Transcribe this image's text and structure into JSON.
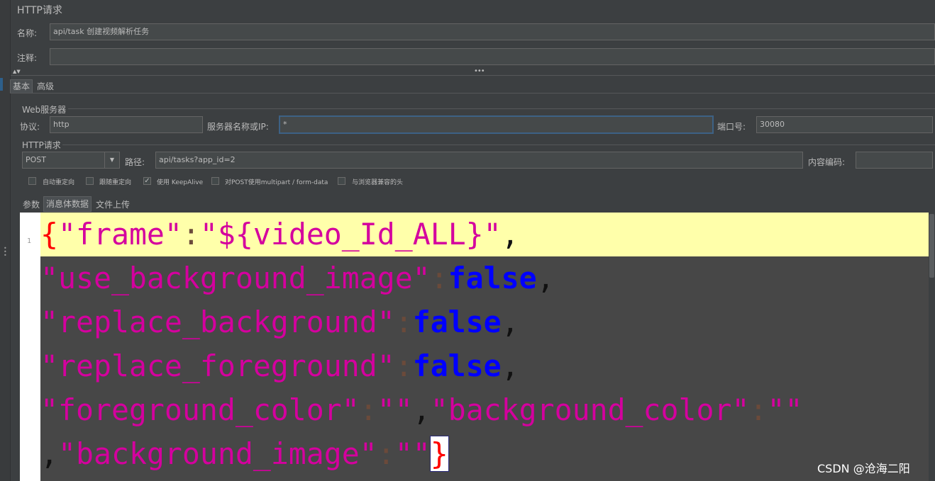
{
  "panel_title": "HTTP请求",
  "name_label": "名称:",
  "name_value": "api/task 创建视频解析任务",
  "comment_label": "注释:",
  "comment_value": "",
  "tabs": [
    {
      "label": "基本",
      "selected": true
    },
    {
      "label": "高级",
      "selected": false
    }
  ],
  "web_server": {
    "section_label": "Web服务器",
    "protocol_label": "协议:",
    "protocol_value": "http",
    "server_label": "服务器名称或IP:",
    "server_value": "*",
    "port_label": "端口号:",
    "port_value": "30080"
  },
  "http_request": {
    "section_label": "HTTP请求",
    "method_value": "POST",
    "path_label": "路径:",
    "path_value": "api/tasks?app_id=2",
    "encoding_label": "内容编码:",
    "encoding_value": ""
  },
  "options": [
    {
      "label": "自动重定向",
      "checked": false
    },
    {
      "label": "跟随重定向",
      "checked": false
    },
    {
      "label": "使用 KeepAlive",
      "checked": true
    },
    {
      "label": "对POST使用multipart / form-data",
      "checked": false
    },
    {
      "label": "与浏览器兼容的头",
      "checked": false
    }
  ],
  "body_tabs": [
    {
      "label": "参数",
      "selected": false
    },
    {
      "label": "消息体数据",
      "selected": true
    },
    {
      "label": "文件上传",
      "selected": false
    }
  ],
  "editor": {
    "line_number": "1",
    "lines": {
      "l1": {
        "brace": "{",
        "key": "\"frame\"",
        "colon": ":",
        "value": "\"${video_Id_ALL}\"",
        "comma": ","
      },
      "l2": {
        "key": "\"use_background_image\"",
        "colon": ":",
        "value": "false",
        "comma": ","
      },
      "l3": {
        "key": "\"replace_background\"",
        "colon": ":",
        "value": "false",
        "comma": ","
      },
      "l4": {
        "key": "\"replace_foreground\"",
        "colon": ":",
        "value": "false",
        "comma": ","
      },
      "l5": {
        "key": "\"foreground_color\"",
        "colon": ":",
        "value": "\"\"",
        "comma": ",",
        "key2": "\"background_color\"",
        "colon2": ":",
        "value2": "\"\""
      },
      "l6": {
        "comma": ",",
        "key": "\"background_image\"",
        "colon": ":",
        "value": "\"\"",
        "brace": "}"
      }
    }
  },
  "watermark": "CSDN @沧海二阳",
  "colors": {
    "background": "#3c3f41",
    "field": "#45494a",
    "editor_bg": "#474747",
    "current_line": "#ffffaa",
    "string": "#d4009e",
    "keyword": "#0000ff",
    "brace": "#ff0000"
  }
}
